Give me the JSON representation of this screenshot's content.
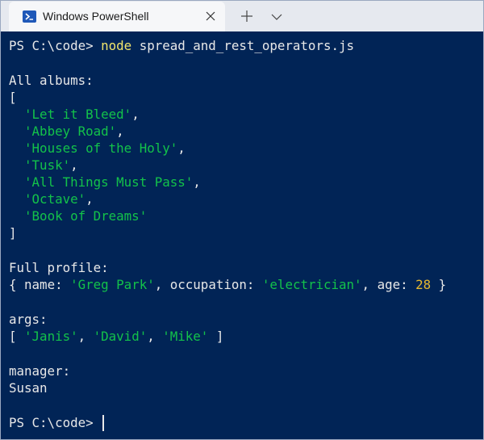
{
  "tab": {
    "title": "Windows PowerShell",
    "icon": "powershell-icon"
  },
  "colors": {
    "background": "#012456",
    "text": "#e8e8e8",
    "string": "#13c24a",
    "number": "#e5b82f",
    "command": "#f2e66c"
  },
  "terminal": {
    "prompt": "PS C:\\code> ",
    "command_name": "node",
    "command_args": " spread_and_rest_operators.js",
    "albums_heading": "All albums:",
    "open_bracket": "[",
    "albums": [
      "'Let it Bleed'",
      "'Abbey Road'",
      "'Houses of the Holy'",
      "'Tusk'",
      "'All Things Must Pass'",
      "'Octave'",
      "'Book of Dreams'"
    ],
    "close_bracket": "]",
    "profile_heading": "Full profile:",
    "profile": {
      "open": "{ ",
      "name_key": "name: ",
      "name_value": "'Greg Park'",
      "sep1": ", ",
      "occupation_key": "occupation: ",
      "occupation_value": "'electrician'",
      "sep2": ", ",
      "age_key": "age: ",
      "age_value": "28",
      "close": " }"
    },
    "args_heading": "args:",
    "args": {
      "open": "[ ",
      "v1": "'Janis'",
      "s1": ", ",
      "v2": "'David'",
      "s2": ", ",
      "v3": "'Mike'",
      "close": " ]"
    },
    "manager_heading": "manager:",
    "manager_value": "Susan",
    "final_prompt": "PS C:\\code> "
  }
}
